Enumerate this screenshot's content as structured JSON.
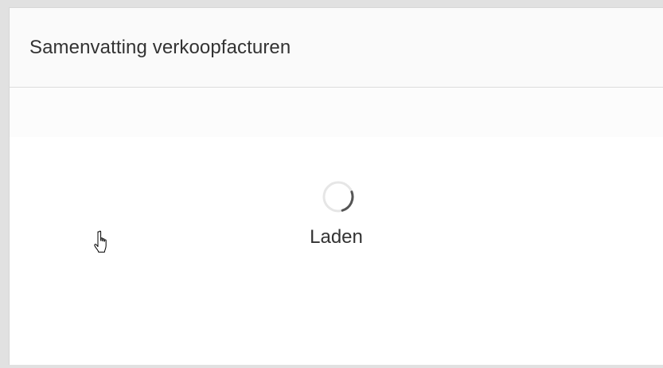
{
  "panel": {
    "title": "Samenvatting verkoopfacturen"
  },
  "loader": {
    "label": "Laden",
    "spinner_icon": "loading-spinner-icon"
  },
  "cursor": {
    "icon": "hand-pointer-cursor-icon"
  },
  "colors": {
    "page_background": "#e1e1e1",
    "header_background": "#fafafa",
    "text": "#333333",
    "spinner_track": "#e6e6e6",
    "spinner_arc": "#555555"
  }
}
